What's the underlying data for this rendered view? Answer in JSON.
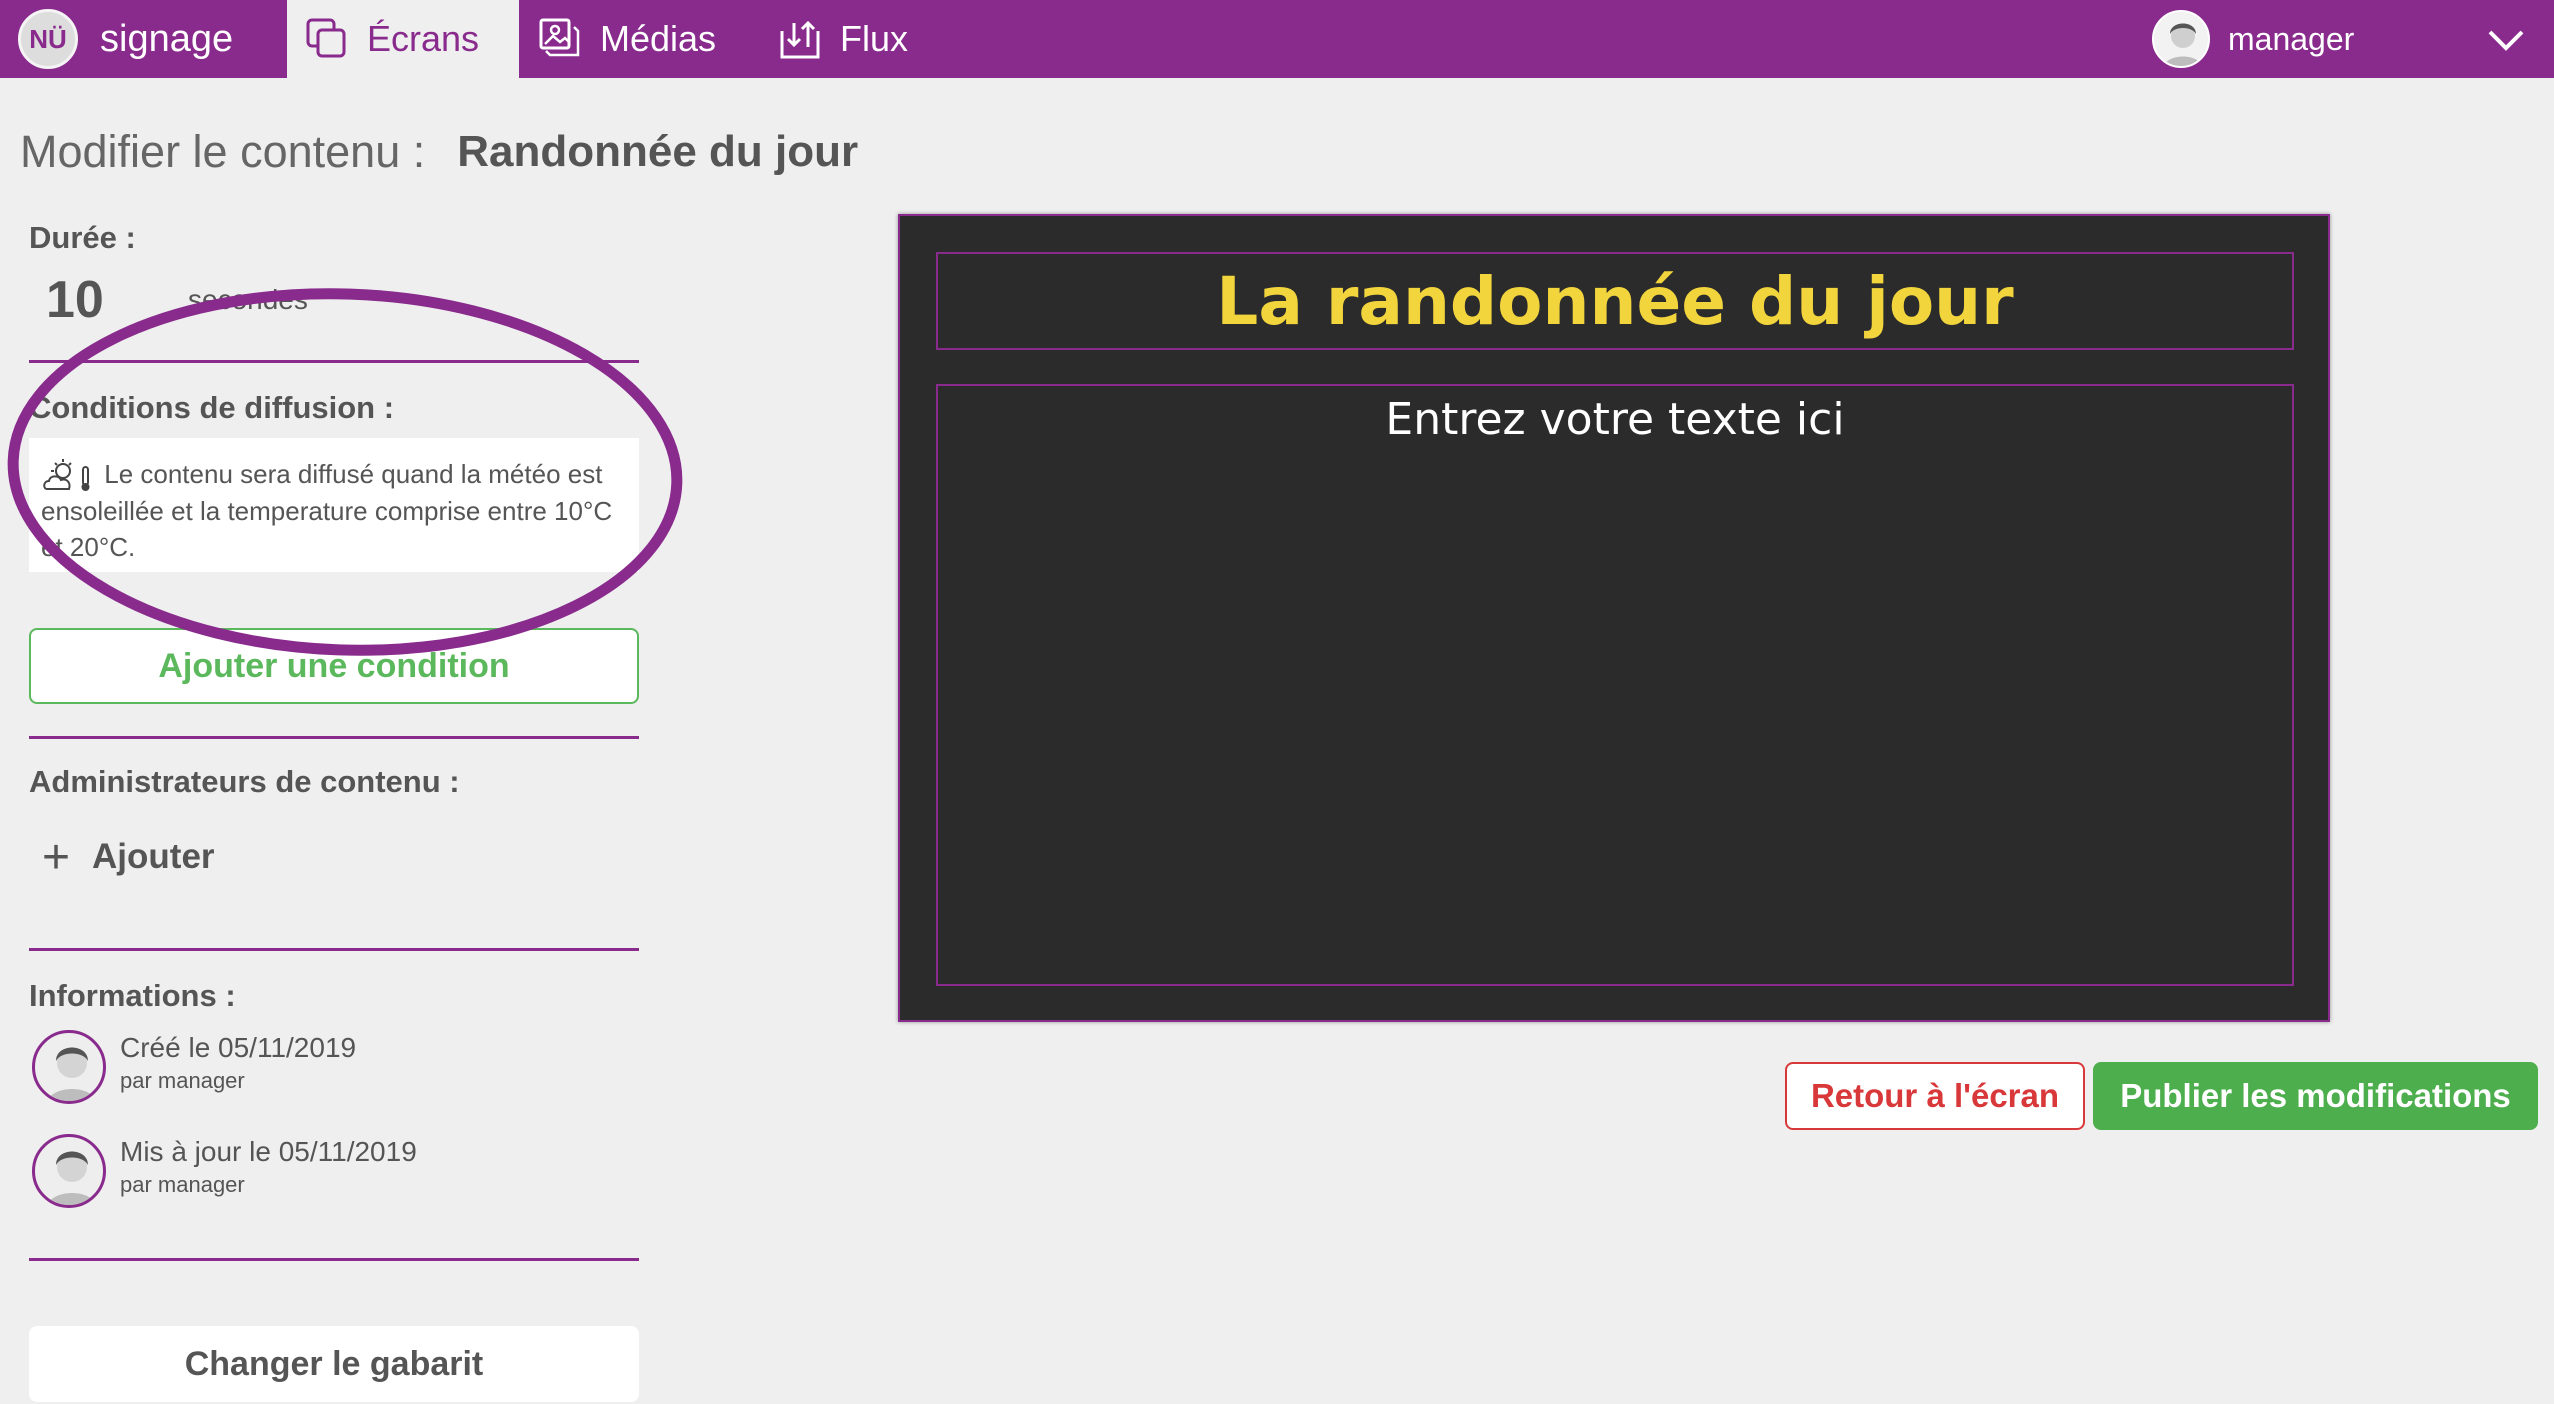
{
  "app": {
    "logo_text": "NÜ",
    "name": "signage"
  },
  "nav": {
    "screens_label": "Écrans",
    "medias_label": "Médias",
    "flux_label": "Flux"
  },
  "user": {
    "name": "manager"
  },
  "page": {
    "title_label": "Modifier le contenu :",
    "title_value": "Randonnée du jour"
  },
  "duration": {
    "label": "Durée :",
    "value": "10",
    "unit": "secondes"
  },
  "conditions": {
    "label": "Conditions de diffusion :",
    "text": "Le contenu sera diffusé quand la météo est ensoleillée et la temperature comprise entre 10°C et 20°C.",
    "add_button": "Ajouter une condition"
  },
  "admins": {
    "label": "Administrateurs de contenu :",
    "add_label": "Ajouter"
  },
  "informations": {
    "label": "Informations :",
    "created": {
      "text": "Créé le 05/11/2019",
      "by": "par manager"
    },
    "updated": {
      "text": "Mis à jour le 05/11/2019",
      "by": "par manager"
    }
  },
  "template_button": "Changer le gabarit",
  "preview": {
    "title": "La randonnée du jour",
    "body_placeholder": "Entrez votre texte ici"
  },
  "actions": {
    "back": "Retour à l'écran",
    "publish": "Publier les modifications"
  },
  "colors": {
    "brand": "#892a8d",
    "success": "#4cae4c",
    "danger": "#d9383a",
    "preview_bg": "#2b2b2b",
    "preview_title": "#f2d43c"
  }
}
